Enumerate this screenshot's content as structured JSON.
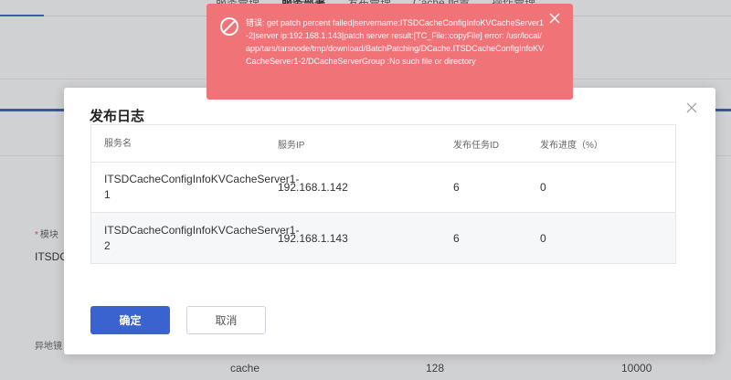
{
  "background": {
    "tabs": [
      "服务管理",
      "服务部署",
      "发布管理",
      "Cache 配置",
      "操作管理"
    ],
    "active_tab_index": 1,
    "form": {
      "module_label": "模块",
      "module_value": "ITSDC",
      "abnormal_label": "异地镜"
    },
    "row": {
      "type": "cache",
      "memory": "128",
      "count": "10000"
    }
  },
  "modal": {
    "title": "发布日志",
    "close_icon": "close-icon",
    "columns": [
      "服务名",
      "服务IP",
      "发布任务ID",
      "发布进度（%）"
    ],
    "rows": [
      {
        "name": "ITSDCacheConfigInfoKVCacheServer1-1",
        "ip": "192.168.1.142",
        "task_id": "6",
        "progress": "0"
      },
      {
        "name": "ITSDCacheConfigInfoKVCacheServer1-2",
        "ip": "192.168.1.143",
        "task_id": "6",
        "progress": "0"
      }
    ],
    "confirm_label": "确定",
    "cancel_label": "取消"
  },
  "toast": {
    "type": "error",
    "icon": "forbidden-icon",
    "message": "错误: get patch percent failed|servername:ITSDCacheConfigInfoKVCacheServer1-2|server ip:192.168.1.143|patch server result:[TC_File::copyFile] error: /usr/local/app/tars/tarsnode/tmp/download/BatchPatching/DCache.ITSDCacheConfigInfoKVCacheServer1-2/DCacheServerGroup :No such file or directory",
    "color": "#f07378"
  },
  "colors": {
    "primary": "#3a63cf",
    "error": "#f07378",
    "nav_accent": "#3f63b8"
  }
}
